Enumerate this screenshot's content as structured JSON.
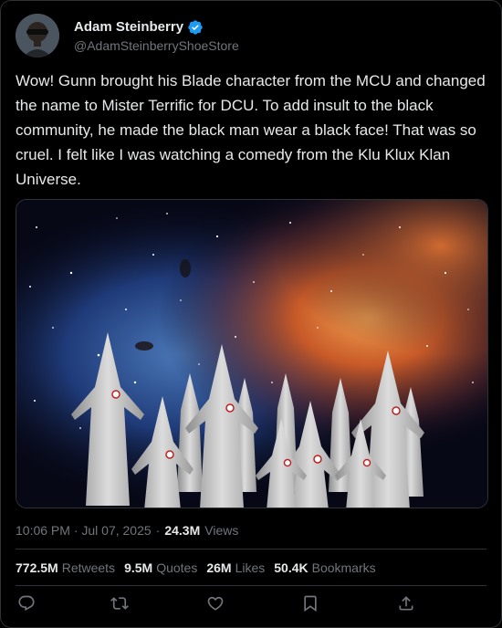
{
  "author": {
    "display_name": "Adam Steinberry",
    "handle": "@AdamSteinberryShoeStore",
    "verified_color": "#1d9bf0"
  },
  "tweet": {
    "text": "Wow! Gunn brought his Blade character from the MCU and changed the name to Mister Terrific for DCU. To add insult to the black community, he made the black man wear a black face! That was so cruel. I felt like I was watching a comedy from the Klu Klux Klan Universe."
  },
  "meta": {
    "timestamp": "10:06 PM · Jul 07, 2025",
    "separator": "·",
    "views_count": "24.3M",
    "views_label": "Views"
  },
  "stats": {
    "retweets_count": "772.5M",
    "retweets_label": "Retweets",
    "quotes_count": "9.5M",
    "quotes_label": "Quotes",
    "likes_count": "26M",
    "likes_label": "Likes",
    "bookmarks_count": "50.4K",
    "bookmarks_label": "Bookmarks"
  },
  "actions": [
    "reply-icon",
    "retweet-icon",
    "like-icon",
    "bookmark-icon",
    "share-icon"
  ],
  "colors": {
    "background": "#000000",
    "text": "#e7e9ea",
    "secondary": "#71767b",
    "border": "#2f3336",
    "accent": "#1d9bf0"
  }
}
